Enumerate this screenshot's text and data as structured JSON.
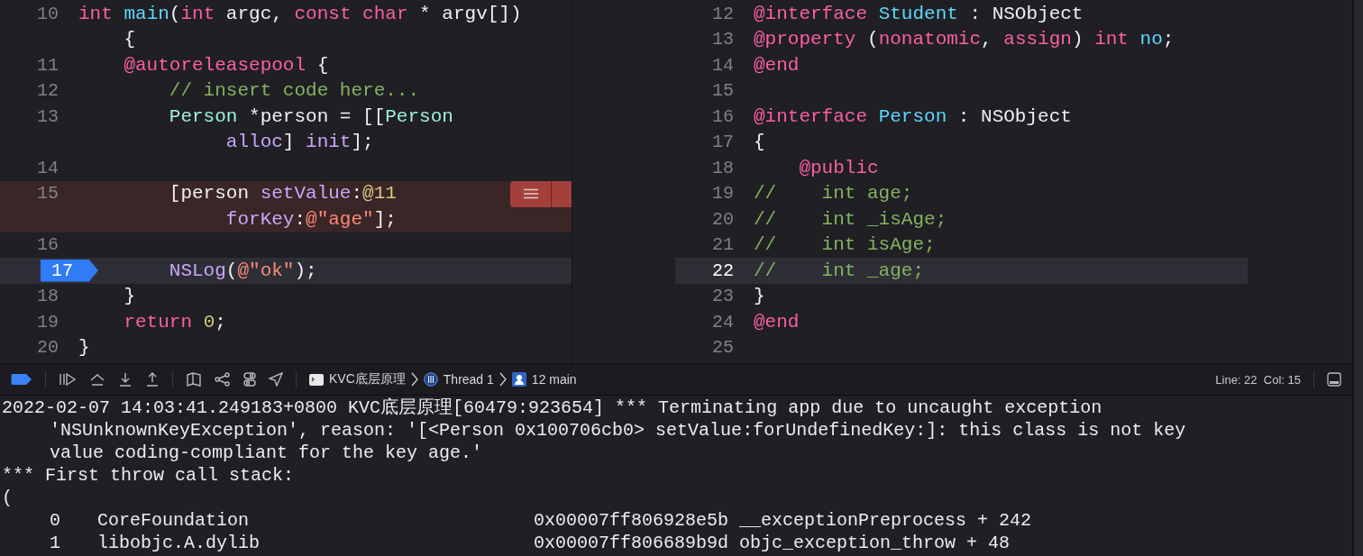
{
  "editor_left": {
    "lines": [
      {
        "number": "10",
        "current": false,
        "error": false,
        "rows": [
          {
            "tokens": [
              {
                "kind": "keyword",
                "text": "int "
              },
              {
                "kind": "declaration",
                "text": "main"
              },
              {
                "kind": "plain",
                "text": "("
              },
              {
                "kind": "keyword",
                "text": "int"
              },
              {
                "kind": "plain",
                "text": " argc, "
              },
              {
                "kind": "keyword",
                "text": "const char"
              },
              {
                "kind": "plain",
                "text": " * argv[])"
              }
            ]
          },
          {
            "tokens": [
              {
                "kind": "plain",
                "text": "    {"
              }
            ]
          }
        ]
      },
      {
        "number": "11",
        "current": false,
        "error": false,
        "rows": [
          {
            "tokens": [
              {
                "kind": "keyword",
                "text": "    @autoreleasepool"
              },
              {
                "kind": "plain",
                "text": " {"
              }
            ]
          }
        ]
      },
      {
        "number": "12",
        "current": false,
        "error": false,
        "rows": [
          {
            "tokens": [
              {
                "kind": "comment",
                "text": "        // insert code here..."
              }
            ]
          }
        ]
      },
      {
        "number": "13",
        "current": false,
        "error": false,
        "rows": [
          {
            "tokens": [
              {
                "kind": "class",
                "text": "        Person"
              },
              {
                "kind": "plain",
                "text": " *person = [["
              },
              {
                "kind": "class",
                "text": "Person"
              }
            ]
          },
          {
            "tokens": [
              {
                "kind": "method",
                "text": "             alloc"
              },
              {
                "kind": "plain",
                "text": "] "
              },
              {
                "kind": "method",
                "text": "init"
              },
              {
                "kind": "plain",
                "text": "];"
              }
            ]
          }
        ]
      },
      {
        "number": "14",
        "current": false,
        "error": false
      },
      {
        "number": "15",
        "current": false,
        "error": true,
        "rows": [
          {
            "tokens": [
              {
                "kind": "plain",
                "text": "        [person "
              },
              {
                "kind": "method",
                "text": "setValue"
              },
              {
                "kind": "plain",
                "text": ":"
              },
              {
                "kind": "number",
                "text": "@11"
              }
            ]
          },
          {
            "tokens": [
              {
                "kind": "method",
                "text": "             forKey"
              },
              {
                "kind": "plain",
                "text": ":"
              },
              {
                "kind": "string",
                "text": "@\"age\""
              },
              {
                "kind": "plain",
                "text": "];"
              }
            ]
          }
        ]
      },
      {
        "number": "16",
        "current": false,
        "error": false
      },
      {
        "number": "17",
        "current": true,
        "error": false,
        "rows": [
          {
            "tokens": [
              {
                "kind": "method",
                "text": "        NSLog"
              },
              {
                "kind": "plain",
                "text": "("
              },
              {
                "kind": "string",
                "text": "@\"ok\""
              },
              {
                "kind": "plain",
                "text": ");"
              }
            ]
          }
        ]
      },
      {
        "number": "18",
        "current": false,
        "error": false,
        "rows": [
          {
            "tokens": [
              {
                "kind": "plain",
                "text": "    }"
              }
            ]
          }
        ]
      },
      {
        "number": "19",
        "current": false,
        "error": false,
        "rows": [
          {
            "tokens": [
              {
                "kind": "keyword",
                "text": "    return "
              },
              {
                "kind": "number",
                "text": "0"
              },
              {
                "kind": "plain",
                "text": ";"
              }
            ]
          }
        ]
      },
      {
        "number": "20",
        "current": false,
        "error": false,
        "rows": [
          {
            "tokens": [
              {
                "kind": "plain",
                "text": "}"
              }
            ]
          }
        ]
      }
    ]
  },
  "editor_right": {
    "lines": [
      {
        "number": "12",
        "highlighted": false,
        "rows": [
          {
            "tokens": [
              {
                "kind": "keyword",
                "text": "@interface "
              },
              {
                "kind": "declaration",
                "text": "Student"
              },
              {
                "kind": "plain",
                "text": " : NSObject"
              }
            ]
          }
        ]
      },
      {
        "number": "13",
        "highlighted": false,
        "rows": [
          {
            "tokens": [
              {
                "kind": "keyword",
                "text": "@property"
              },
              {
                "kind": "plain",
                "text": " ("
              },
              {
                "kind": "keyword",
                "text": "nonatomic"
              },
              {
                "kind": "plain",
                "text": ", "
              },
              {
                "kind": "keyword",
                "text": "assign"
              },
              {
                "kind": "plain",
                "text": ") "
              },
              {
                "kind": "keyword",
                "text": "int "
              },
              {
                "kind": "declaration",
                "text": "no"
              },
              {
                "kind": "plain",
                "text": ";"
              }
            ]
          }
        ]
      },
      {
        "number": "14",
        "highlighted": false,
        "rows": [
          {
            "tokens": [
              {
                "kind": "keyword",
                "text": "@end"
              }
            ]
          }
        ]
      },
      {
        "number": "15",
        "highlighted": false
      },
      {
        "number": "16",
        "highlighted": false,
        "rows": [
          {
            "tokens": [
              {
                "kind": "keyword",
                "text": "@interface "
              },
              {
                "kind": "declaration",
                "text": "Person"
              },
              {
                "kind": "plain",
                "text": " : NSObject"
              }
            ]
          }
        ]
      },
      {
        "number": "17",
        "highlighted": false,
        "rows": [
          {
            "tokens": [
              {
                "kind": "plain",
                "text": "{"
              }
            ]
          }
        ]
      },
      {
        "number": "18",
        "highlighted": false,
        "rows": [
          {
            "tokens": [
              {
                "kind": "keyword",
                "text": "    @public"
              }
            ]
          }
        ]
      },
      {
        "number": "19",
        "highlighted": false,
        "rows": [
          {
            "tokens": [
              {
                "kind": "comment",
                "text": "//    int age;"
              }
            ]
          }
        ]
      },
      {
        "number": "20",
        "highlighted": false,
        "rows": [
          {
            "tokens": [
              {
                "kind": "comment",
                "text": "//    int _isAge;"
              }
            ]
          }
        ]
      },
      {
        "number": "21",
        "highlighted": false,
        "rows": [
          {
            "tokens": [
              {
                "kind": "comment",
                "text": "//    int isAge;"
              }
            ]
          }
        ]
      },
      {
        "number": "22",
        "highlighted": true,
        "rows": [
          {
            "tokens": [
              {
                "kind": "comment",
                "text": "//    int _age;"
              }
            ]
          }
        ]
      },
      {
        "number": "23",
        "highlighted": false,
        "rows": [
          {
            "tokens": [
              {
                "kind": "plain",
                "text": "}"
              }
            ]
          }
        ]
      },
      {
        "number": "24",
        "highlighted": false,
        "rows": [
          {
            "tokens": [
              {
                "kind": "keyword",
                "text": "@end"
              }
            ]
          }
        ]
      },
      {
        "number": "25",
        "highlighted": false
      }
    ]
  },
  "debug_bar": {
    "breadcrumb": [
      {
        "kind": "process",
        "label": "KVC底层原理"
      },
      {
        "kind": "thread",
        "label": "Thread 1"
      },
      {
        "kind": "frame",
        "label": "12 main"
      }
    ],
    "position": "Line: 22  Col: 15"
  },
  "console": {
    "lines": [
      {
        "kind": "text",
        "text": "2022-02-07 14:03:41.249183+0800 KVC底层原理[60479:923654] *** Terminating app due to uncaught exception"
      },
      {
        "kind": "wrap",
        "text": "'NSUnknownKeyException', reason: '[<Person 0x100706cb0> setValue:forUndefinedKey:]: this class is not key"
      },
      {
        "kind": "wrap",
        "text": "value coding-compliant for the key age.'"
      },
      {
        "kind": "text",
        "text": "*** First throw call stack:"
      },
      {
        "kind": "text",
        "text": "("
      },
      {
        "kind": "frame",
        "index": "0",
        "library": "CoreFoundation",
        "detail": "0x00007ff806928e5b __exceptionPreprocess + 242"
      },
      {
        "kind": "frame",
        "index": "1",
        "library": "libobjc.A.dylib",
        "detail": "0x00007ff806689b9d objc_exception_throw + 48"
      }
    ]
  }
}
